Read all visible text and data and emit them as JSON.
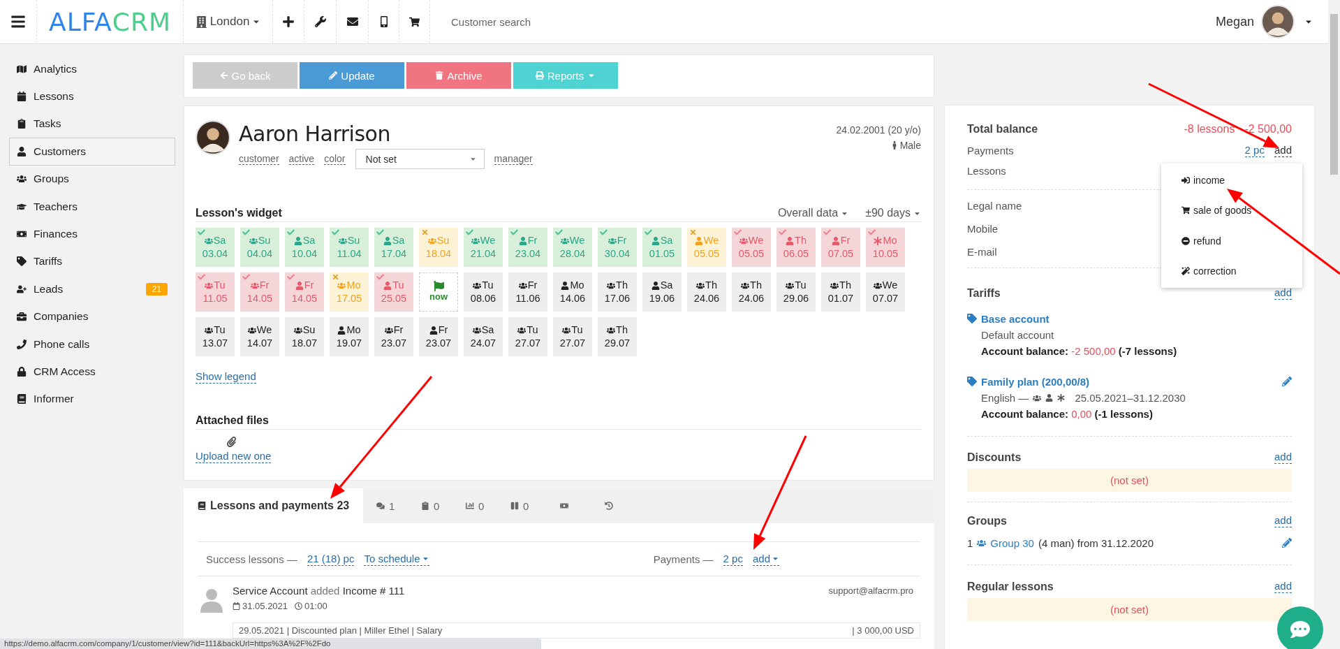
{
  "top_bar": {
    "logo": [
      {
        "text": "ALFA",
        "color": "#2f86e8"
      },
      {
        "text": "CRM",
        "color": "#4ccf8a"
      }
    ],
    "branch": "London",
    "search": {
      "placeholder": "Customer search"
    },
    "user": {
      "name": "Megan"
    }
  },
  "sidebar": {
    "items": [
      {
        "label": "Analytics",
        "selected": false
      },
      {
        "label": "Lessons",
        "selected": false
      },
      {
        "label": "Tasks",
        "selected": false
      },
      {
        "label": "Customers",
        "selected": true
      },
      {
        "label": "Groups",
        "selected": false
      },
      {
        "label": "Teachers",
        "selected": false
      },
      {
        "label": "Finances",
        "selected": false
      },
      {
        "label": "Tariffs",
        "selected": false
      },
      {
        "label": "Leads",
        "selected": false,
        "badge": "21"
      },
      {
        "label": "Companies",
        "selected": false
      },
      {
        "label": "Phone calls",
        "selected": false
      },
      {
        "label": "CRM Access",
        "selected": false
      },
      {
        "label": "Informer",
        "selected": false
      }
    ]
  },
  "actions": [
    {
      "label": "Go back",
      "kind": "back"
    },
    {
      "label": "Update",
      "kind": "update"
    },
    {
      "label": "Archive",
      "kind": "archive"
    },
    {
      "label": "Reports",
      "kind": "reports"
    }
  ],
  "profile": {
    "name": "Aaron Harrison",
    "birth": "24.02.2001 (20 y/o)",
    "gender": "Male",
    "fields": [
      "customer",
      "active",
      "color"
    ],
    "color_select": {
      "value": "Not set"
    },
    "manager": "manager"
  },
  "widget": {
    "title": "Lesson's widget",
    "filters": [
      "Overall data",
      "±90 days"
    ],
    "legend_link": "Show legend",
    "lessons": [
      {
        "day": "Sa",
        "date": "03.04",
        "kind": "attended",
        "group": true,
        "trial": false
      },
      {
        "day": "Su",
        "date": "04.04",
        "kind": "attended",
        "group": true,
        "trial": false
      },
      {
        "day": "Sa",
        "date": "10.04",
        "kind": "attended",
        "group": false,
        "trial": false
      },
      {
        "day": "Su",
        "date": "11.04",
        "kind": "attended",
        "group": true,
        "trial": false
      },
      {
        "day": "Sa",
        "date": "17.04",
        "kind": "attended",
        "group": false,
        "trial": false
      },
      {
        "day": "Su",
        "date": "18.04",
        "kind": "missed",
        "group": true,
        "trial": false
      },
      {
        "day": "We",
        "date": "21.04",
        "kind": "attended",
        "group": true,
        "trial": false
      },
      {
        "day": "Fr",
        "date": "23.04",
        "kind": "attended",
        "group": false,
        "trial": false
      },
      {
        "day": "We",
        "date": "28.04",
        "kind": "attended",
        "group": true,
        "trial": false
      },
      {
        "day": "Fr",
        "date": "30.04",
        "kind": "attended",
        "group": true,
        "trial": false
      },
      {
        "day": "Sa",
        "date": "01.05",
        "kind": "attended",
        "group": false,
        "trial": false
      },
      {
        "day": "We",
        "date": "05.05",
        "kind": "missed",
        "group": false,
        "trial": false
      },
      {
        "day": "We",
        "date": "05.05",
        "kind": "unpaid",
        "group": true,
        "trial": false
      },
      {
        "day": "Th",
        "date": "06.05",
        "kind": "unpaid",
        "group": false,
        "trial": false
      },
      {
        "day": "Fr",
        "date": "07.05",
        "kind": "unpaid",
        "group": false,
        "trial": false
      },
      {
        "day": "Mo",
        "date": "10.05",
        "kind": "unpaid",
        "trial": true
      },
      {
        "day": "Tu",
        "date": "11.05",
        "kind": "unpaid",
        "group": true,
        "trial": false
      },
      {
        "day": "Fr",
        "date": "14.05",
        "kind": "unpaid",
        "group": true,
        "trial": false
      },
      {
        "day": "Fr",
        "date": "14.05",
        "kind": "unpaid",
        "group": false,
        "trial": false
      },
      {
        "day": "Mo",
        "date": "17.05",
        "kind": "missed",
        "group": true,
        "trial": false
      },
      {
        "day": "Tu",
        "date": "25.05",
        "kind": "unpaid",
        "group": false,
        "trial": false
      },
      {
        "date": "now",
        "kind": "now"
      },
      {
        "day": "Tu",
        "date": "08.06",
        "kind": "planned",
        "group": true,
        "trial": false
      },
      {
        "day": "Fr",
        "date": "11.06",
        "kind": "planned",
        "group": true,
        "trial": false
      },
      {
        "day": "Mo",
        "date": "14.06",
        "kind": "planned",
        "group": false,
        "trial": false
      },
      {
        "day": "Th",
        "date": "17.06",
        "kind": "planned",
        "group": true,
        "trial": false
      },
      {
        "day": "Sa",
        "date": "19.06",
        "kind": "planned",
        "group": false,
        "trial": false
      },
      {
        "day": "Th",
        "date": "24.06",
        "kind": "planned",
        "group": true,
        "trial": false
      },
      {
        "day": "Th",
        "date": "24.06",
        "kind": "planned",
        "group": true,
        "trial": false
      },
      {
        "day": "Tu",
        "date": "29.06",
        "kind": "planned",
        "group": true,
        "trial": false
      },
      {
        "day": "Th",
        "date": "01.07",
        "kind": "planned",
        "group": true,
        "trial": false
      },
      {
        "day": "We",
        "date": "07.07",
        "kind": "planned",
        "group": true,
        "trial": false
      },
      {
        "day": "Tu",
        "date": "13.07",
        "kind": "planned",
        "group": true,
        "trial": false
      },
      {
        "day": "We",
        "date": "14.07",
        "kind": "planned",
        "group": true,
        "trial": false
      },
      {
        "day": "Su",
        "date": "18.07",
        "kind": "planned",
        "group": true,
        "trial": false
      },
      {
        "day": "Mo",
        "date": "19.07",
        "kind": "planned",
        "group": false,
        "trial": false
      },
      {
        "day": "Fr",
        "date": "23.07",
        "kind": "planned",
        "group": true,
        "trial": false
      },
      {
        "day": "Fr",
        "date": "23.07",
        "kind": "planned",
        "group": false,
        "trial": false
      },
      {
        "day": "Sa",
        "date": "24.07",
        "kind": "planned",
        "group": true,
        "trial": false
      },
      {
        "day": "Tu",
        "date": "27.07",
        "kind": "planned",
        "group": true,
        "trial": false
      },
      {
        "day": "Tu",
        "date": "27.07",
        "kind": "planned",
        "group": true,
        "trial": false
      },
      {
        "day": "Th",
        "date": "29.07",
        "kind": "planned",
        "group": true,
        "trial": false
      }
    ]
  },
  "files": {
    "title": "Attached files",
    "upload": "Upload new one"
  },
  "tabs": [
    {
      "label": "Lessons and payments 23",
      "selected": true
    },
    {
      "label": "1",
      "selected": false
    },
    {
      "label": "0",
      "selected": false
    },
    {
      "label": "0",
      "selected": false
    },
    {
      "label": "0",
      "selected": false
    },
    {
      "selected": false
    },
    {
      "selected": false
    }
  ],
  "summary": {
    "success_label": "Success lessons —",
    "success_value": "21 (18) pc",
    "schedule": "To schedule",
    "payments_label": "Payments —",
    "payments_value": "2 pc",
    "add": "add"
  },
  "feed": [
    {
      "author": "Service Account",
      "action": "added",
      "object": "Income # 111",
      "date": "31.05.2021",
      "time": "01:00",
      "email": "support@alfacrm.pro",
      "detail": "29.05.2021 | Discounted plan | Miller Ethel | Salary",
      "amount": "| 3 000,00 USD"
    }
  ],
  "balance": {
    "title": "Total balance",
    "lessons": "-8 lessons",
    "amount": "-2 500,00",
    "payments_label": "Payments",
    "payments_value": "2 pc",
    "add": "add",
    "lessons_label": "Lessons",
    "contacts": [
      "Legal name",
      "Mobile",
      "E-mail"
    ]
  },
  "add_menu": {
    "items": [
      {
        "label": "income"
      },
      {
        "label": "sale of goods"
      },
      {
        "label": "refund"
      },
      {
        "label": "correction"
      }
    ]
  },
  "tariffs": {
    "title": "Tariffs",
    "add": "add",
    "items": [
      {
        "name": "Base account",
        "subtitle": "Default account",
        "balance_label": "Account balance:",
        "balance": "-2 500,00",
        "lessons": "(-7 lessons)",
        "editable": false
      },
      {
        "name": "Family plan (200,00/8)",
        "subject": "English —",
        "period": "25.05.2021–31.12.2030",
        "balance_label": "Account balance:",
        "balance": "0,00",
        "lessons": "(-1 lessons)",
        "editable": true
      }
    ]
  },
  "discounts": {
    "title": "Discounts",
    "add": "add",
    "empty": "(not set)"
  },
  "groups": {
    "title": "Groups",
    "add": "add",
    "items": [
      {
        "count": "1",
        "name": "Group 30",
        "size": "(4 man)",
        "since": "from 31.12.2020",
        "editable": true
      }
    ]
  },
  "regular_lessons": {
    "title": "Regular lessons",
    "add": "add",
    "empty": "(not set)"
  },
  "status_url": "https://demo.alfacrm.com/company/1/customer/view?id=111&backUrl=https%3A%2F%2Fdo"
}
